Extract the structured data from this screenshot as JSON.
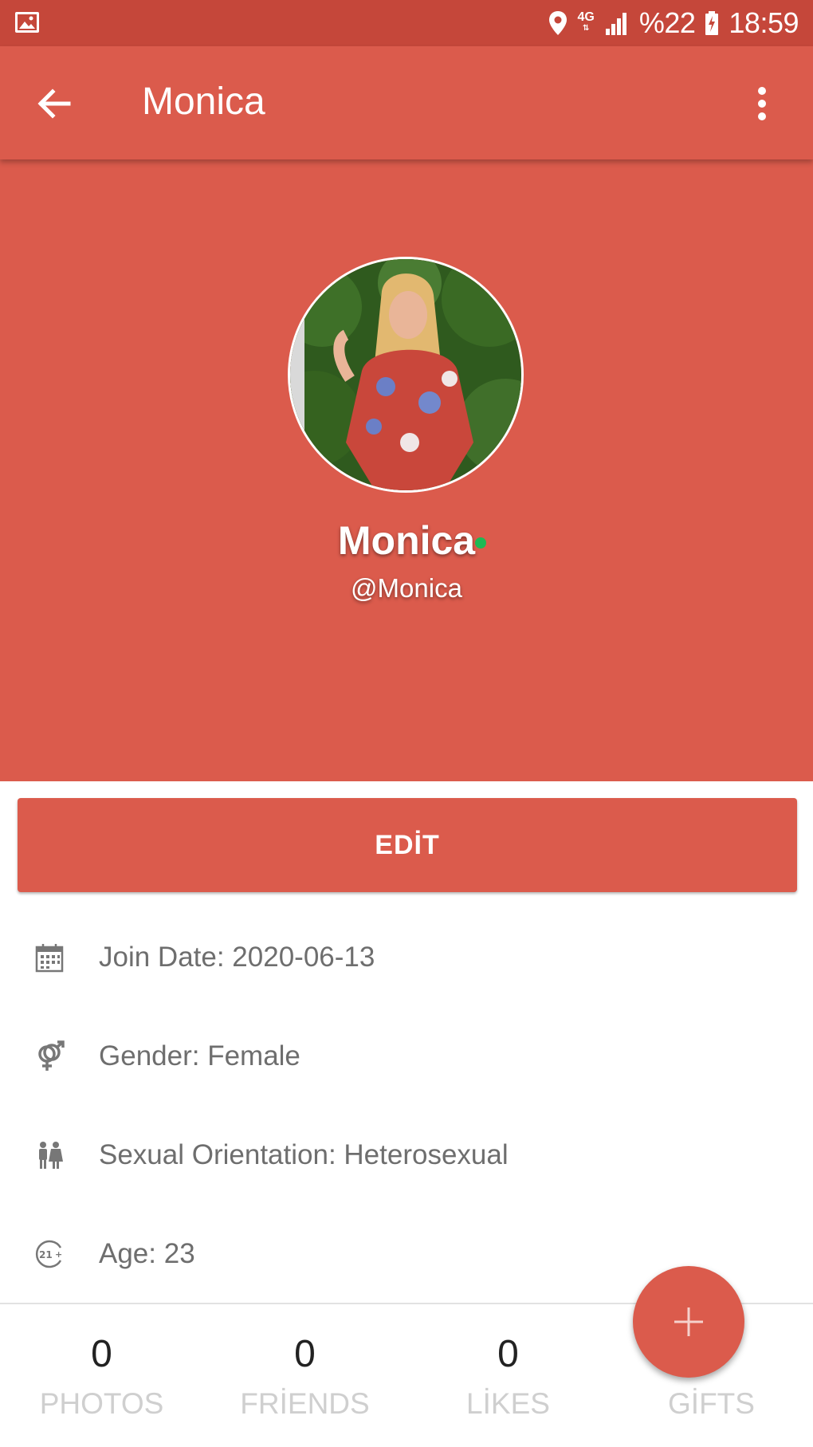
{
  "status_bar": {
    "battery_percent": "%22",
    "time": "18:59",
    "network": "4G",
    "icons": [
      "image-icon",
      "location-icon",
      "signal-icon",
      "battery-charging-icon"
    ]
  },
  "app_bar": {
    "title": "Monica",
    "icons": [
      "back-arrow-icon",
      "more-vert-icon"
    ]
  },
  "profile": {
    "display_name": "Monica",
    "username": "@Monica",
    "online": true
  },
  "edit_button": {
    "label": "EDİT"
  },
  "info": {
    "join_date": "Join Date: 2020-06-13",
    "gender": "Gender: Female",
    "orientation": "Sexual Orientation: Heterosexual",
    "age": "Age: 23"
  },
  "stats": [
    {
      "value": "0",
      "label": "PHOTOS"
    },
    {
      "value": "0",
      "label": "FRİENDS"
    },
    {
      "value": "0",
      "label": "LİKES"
    },
    {
      "value": "",
      "label": "GİFTS"
    }
  ],
  "fab": {
    "icon": "plus-icon"
  },
  "colors": {
    "primary": "#db5b4c",
    "primary_dark": "#c5473a",
    "online": "#1db954",
    "text_secondary": "#6e6e6e",
    "stat_label": "#cfcfcf"
  }
}
